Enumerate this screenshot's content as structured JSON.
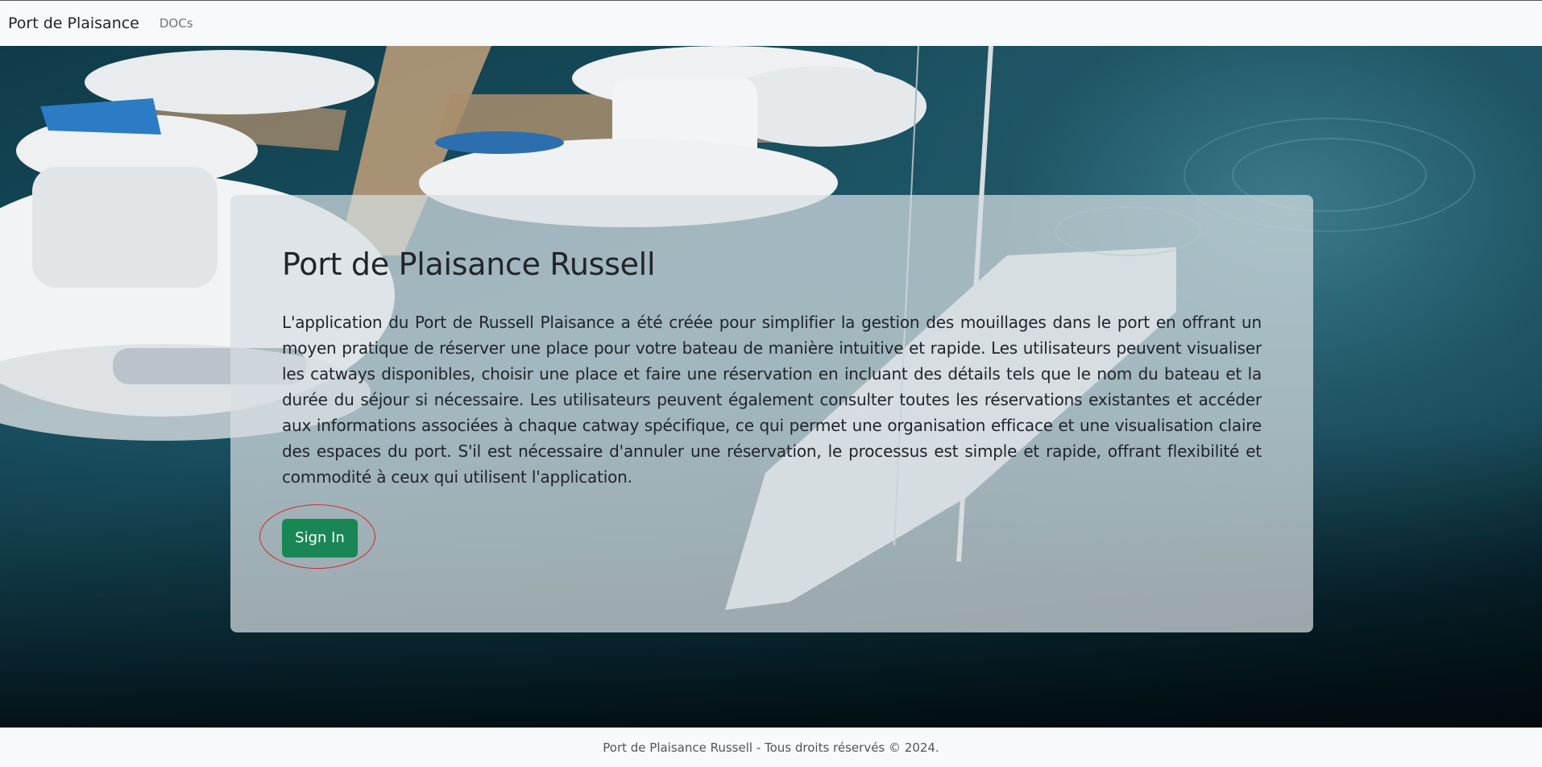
{
  "navbar": {
    "brand": "Port de Plaisance",
    "links": [
      {
        "label": "DOCs"
      }
    ]
  },
  "hero": {
    "title": "Port de Plaisance Russell",
    "description": "L'application du Port de Russell Plaisance a été créée pour simplifier la gestion des mouillages dans le port en offrant un moyen pratique de réserver une place pour votre bateau de manière intuitive et rapide. Les utilisateurs peuvent visualiser les catways disponibles, choisir une place et faire une réservation en incluant des détails tels que le nom du bateau et la durée du séjour si nécessaire. Les utilisateurs peuvent également consulter toutes les réservations existantes et accéder aux informations associées à chaque catway spécifique, ce qui permet une organisation efficace et une visualisation claire des espaces du port. S'il est nécessaire d'annuler une réservation, le processus est simple et rapide, offrant flexibilité et commodité à ceux qui utilisent l'application.",
    "sign_in_label": "Sign In",
    "background_image": "marina-boats-aerial-photo"
  },
  "footer": {
    "text": "Port de Plaisance Russell - Tous droits réservés © 2024."
  },
  "colors": {
    "navbar_bg": "#f8f9fa",
    "button_bg": "#198754",
    "annotation_circle": "#d62828",
    "water": "#1a5566"
  }
}
